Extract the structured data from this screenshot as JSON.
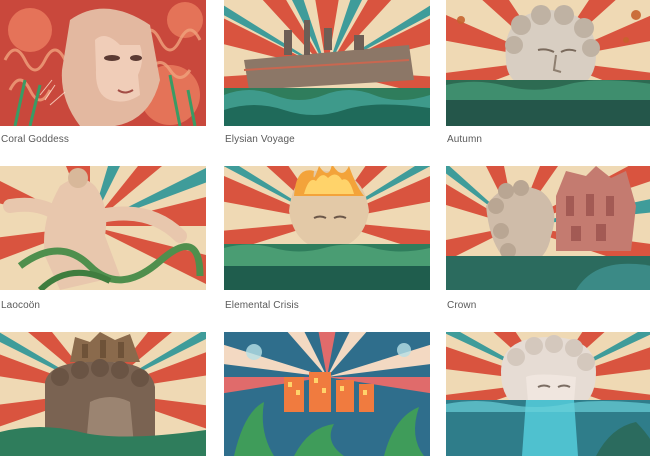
{
  "gallery": {
    "items": [
      {
        "title": "Coral Goddess",
        "icon": "coral-goddess-artwork"
      },
      {
        "title": "Elysian Voyage",
        "icon": "elysian-voyage-artwork"
      },
      {
        "title": "Autumn",
        "icon": "autumn-artwork"
      },
      {
        "title": "Laocoön",
        "icon": "laocoon-artwork"
      },
      {
        "title": "Elemental Crisis",
        "icon": "elemental-crisis-artwork"
      },
      {
        "title": "Crown",
        "icon": "crown-artwork"
      },
      {
        "title": "",
        "icon": "crowned-head-artwork"
      },
      {
        "title": "",
        "icon": "psychedelic-city-artwork"
      },
      {
        "title": "",
        "icon": "submerged-woman-artwork"
      }
    ]
  },
  "colors": {
    "ray_red": "#d9543f",
    "ray_cream": "#efd9b4",
    "ray_teal": "#3f9c9a",
    "sea_green": "#2f7d5c",
    "caption": "#5a5a5a"
  }
}
